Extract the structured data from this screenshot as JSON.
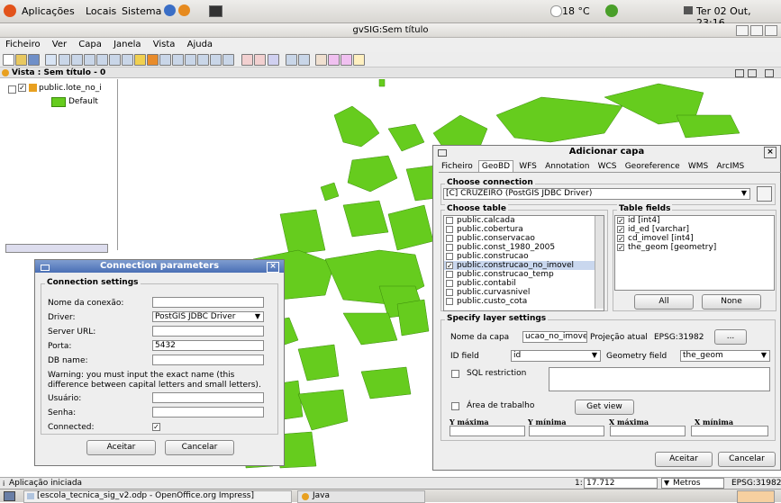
{
  "panel": {
    "menu": [
      "Aplicações",
      "Locais",
      "Sistema"
    ],
    "weather": "18 °C",
    "clock": "Ter 02 Out, 23:16"
  },
  "window": {
    "title": "gvSIG:Sem título"
  },
  "menubar": [
    "Ficheiro",
    "Ver",
    "Capa",
    "Janela",
    "Vista",
    "Ajuda"
  ],
  "view": {
    "title": "Vista : Sem título - 0"
  },
  "toc": {
    "layer": "public.lote_no_i",
    "legend": "Default"
  },
  "status": {
    "left": "Aplicação iniciada",
    "scale_prefix": "1:",
    "scale": "17.712",
    "units": "Metros",
    "epsg": "EPSG:31982"
  },
  "taskbar": {
    "impress": "[escola_tecnica_sig_v2.odp - OpenOffice.org Impress]",
    "java": "Java"
  },
  "add_layer": {
    "title": "Adicionar capa",
    "tabs": [
      "Ficheiro",
      "GeoBD",
      "WFS",
      "Annotation",
      "WCS",
      "Georeference",
      "WMS",
      "ArcIMS"
    ],
    "choose_connection": "Choose connection",
    "connection": "[C] CRUZEIRO (PostGIS JDBC Driver)",
    "choose_table": "Choose table",
    "tables": [
      "public.calcada",
      "public.cobertura",
      "public.conservacao",
      "public.const_1980_2005",
      "public.construcao",
      "public.construcao_no_imovel",
      "public.construcao_temp",
      "public.contabil",
      "public.curvasnivel",
      "public.custo_cota"
    ],
    "selected_table_index": 5,
    "table_fields": "Table fields",
    "fields": [
      "id [int4]",
      "id_ed [varchar]",
      "cd_imovel [int4]",
      "the_geom [geometry]"
    ],
    "all": "All",
    "none": "None",
    "specify_layer": "Specify layer settings",
    "layer_name_label": "Nome da capa",
    "layer_name": "ucao_no_imovel",
    "projection_label": "Projeção atual",
    "projection": "EPSG:31982",
    "proj_button": "...",
    "id_field_label": "ID field",
    "id_field": "id",
    "geom_field_label": "Geometry field",
    "geom_field": "the_geom",
    "sql": "SQL restriction",
    "area": "Área de trabalho",
    "get_view": "Get view",
    "ymax": "Y máxima",
    "ymin": "Y mínima",
    "xmax": "X máxima",
    "xmin": "X mínima",
    "accept": "Aceitar",
    "cancel": "Cancelar"
  },
  "conn": {
    "title": "Connection parameters",
    "group": "Connection settings",
    "name_label": "Nome da conexão:",
    "driver_label": "Driver:",
    "driver": "PostGIS JDBC Driver",
    "url_label": "Server URL:",
    "port_label": "Porta:",
    "port": "5432",
    "db_label": "DB name:",
    "warning": "Warning: you must input the exact name (this difference between capital letters and small letters).",
    "user_label": "Usuário:",
    "pass_label": "Senha:",
    "connected_label": "Connected:",
    "accept": "Aceitar",
    "cancel": "Cancelar"
  }
}
